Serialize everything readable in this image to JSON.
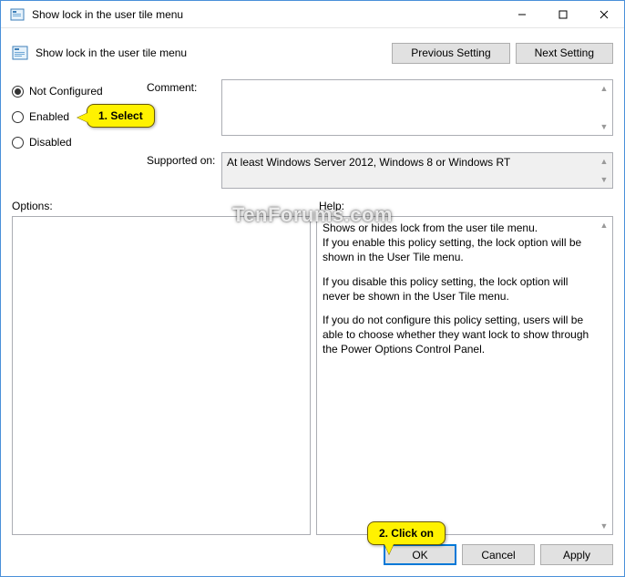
{
  "titlebar": {
    "text": "Show lock in the user tile menu"
  },
  "header": {
    "title": "Show lock in the user tile menu",
    "prev": "Previous Setting",
    "next": "Next Setting"
  },
  "radios": {
    "not_configured": "Not Configured",
    "enabled": "Enabled",
    "disabled": "Disabled"
  },
  "fields": {
    "comment_label": "Comment:",
    "supported_label": "Supported on:",
    "supported_text": "At least Windows Server 2012, Windows 8 or Windows RT"
  },
  "labels": {
    "options": "Options:",
    "help": "Help:"
  },
  "help": {
    "p1": "Shows or hides lock from the user tile menu.",
    "p2": "If you enable this policy setting, the lock option will be shown in the User Tile menu.",
    "p3": "If you disable this policy setting, the lock option will never be shown in the User Tile menu.",
    "p4": "If you do not configure this policy setting, users will be able to choose whether they want lock to show through the Power Options Control Panel."
  },
  "footer": {
    "ok": "OK",
    "cancel": "Cancel",
    "apply": "Apply"
  },
  "callouts": {
    "c1": "1. Select",
    "c2": "2. Click on"
  },
  "watermark": "TenForums.com"
}
